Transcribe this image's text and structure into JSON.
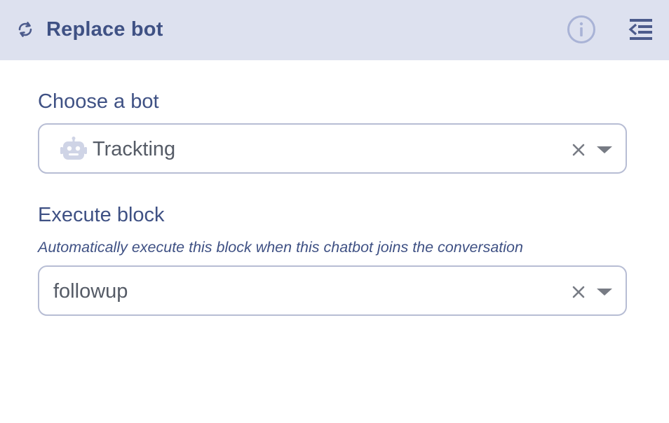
{
  "header": {
    "title": "Replace bot",
    "refresh_icon": "refresh-icon",
    "info_icon": "info-circle-icon",
    "collapse_icon": "collapse-panel-icon"
  },
  "bot_field": {
    "label": "Choose a bot",
    "value": "Trackting",
    "value_icon": "robot-icon",
    "clear_icon": "close-icon",
    "caret_icon": "caret-down-icon"
  },
  "block_field": {
    "label": "Execute block",
    "hint": "Automatically execute this block when this chatbot joins the conversation",
    "value": "followup",
    "clear_icon": "close-icon",
    "caret_icon": "caret-down-icon"
  },
  "colors": {
    "header_bg": "#dde1ef",
    "accent_text": "#3f5184",
    "icon_color": "#4c5b8c",
    "info_icon_color": "#a9b3d6",
    "field_border": "#b7bdd4",
    "value_text": "#555b66",
    "control_icon": "#777b84"
  }
}
